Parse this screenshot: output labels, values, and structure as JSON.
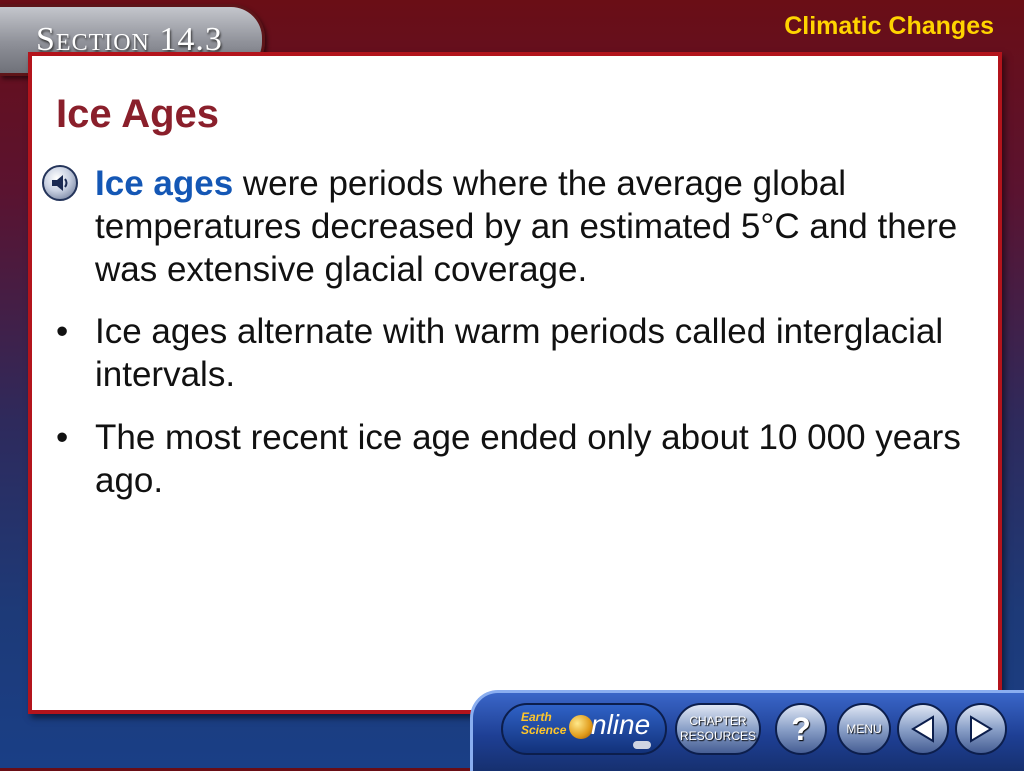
{
  "header": {
    "section_label": "Section 14.3",
    "chapter_title": "Climatic Changes"
  },
  "slide": {
    "heading": "Ice Ages",
    "bullets": [
      {
        "marker": "speaker-icon",
        "term": "Ice ages",
        "text": " were periods where the average global temperatures decreased by an estimated 5°C and there was extensive glacial coverage."
      },
      {
        "marker": "•",
        "text": "Ice ages alternate with warm periods called interglacial intervals."
      },
      {
        "marker": "•",
        "text": "The most recent ice age ended only about 10 000 years ago."
      }
    ]
  },
  "navbar": {
    "online_logo": {
      "line1": "Earth",
      "line2": "Science",
      "word": "nline"
    },
    "chapter_resources": {
      "line1": "CHAPTER",
      "line2": "RESOURCES"
    },
    "help": "?",
    "menu": "MENU",
    "prev_icon": "left-arrow-icon",
    "next_icon": "right-arrow-icon"
  },
  "colors": {
    "heading": "#8a1f2b",
    "keyword": "#1457b5",
    "chapter_title": "#ffd400",
    "slide_border": "#b3141c"
  }
}
